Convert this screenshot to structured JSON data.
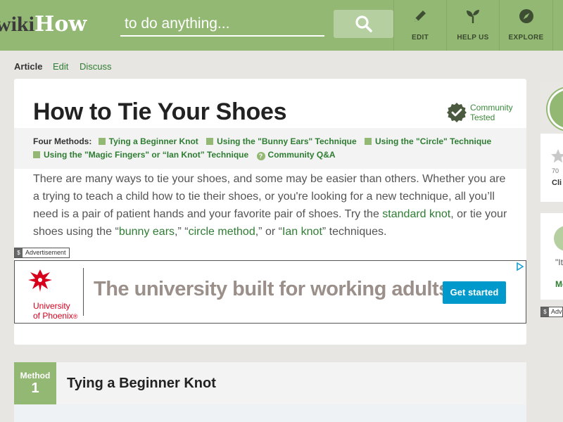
{
  "header": {
    "logo_wiki": "wiki",
    "logo_how": "How",
    "search_placeholder": "to do anything...",
    "nav": [
      {
        "label": "EDIT",
        "icon": "pencil-icon"
      },
      {
        "label": "HELP US",
        "icon": "sprout-icon"
      },
      {
        "label": "EXPLORE",
        "icon": "compass-icon"
      }
    ]
  },
  "tabs": [
    "Article",
    "Edit",
    "Discuss"
  ],
  "article": {
    "title": "How to Tie Your Shoes",
    "badge_line1": "Community",
    "badge_line2": "Tested",
    "methods_lead": "Four Methods:",
    "methods": [
      "Tying a Beginner Knot",
      "Using the \"Bunny Ears\" Technique",
      "Using the \"Circle\" Technique",
      "Using the \"Magic Fingers\" or “Ian Knot” Technique"
    ],
    "qa_link": "Community Q&A",
    "intro": {
      "p1": "There are many ways to tie your shoes, and some may be easier than others. Whether you are a trying to teach a child how to tie their shoes, or you're looking for a new technique, all you’ll need is a pair of patient hands and your favorite pair of shoes. Try the ",
      "l1": "standard knot",
      "p2": ", or tie your shoes using the “",
      "l2": "bunny ears",
      "p3": ",” “",
      "l3": "circle method",
      "p4": ",” or “",
      "l4": "Ian knot",
      "p5": "” techniques."
    }
  },
  "ad": {
    "tag": "Advertisement",
    "tag_icon": "$",
    "brand_line1": "University",
    "brand_line2": "of Phoenix",
    "brand_mark": "®",
    "headline": "The university built for working adults",
    "cta": "Get started",
    "brand_color": "#d6001c",
    "cta_color": "#0099cc"
  },
  "method": {
    "word": "Method",
    "number": "1",
    "title": "Tying a Beginner Knot"
  },
  "sidebar": {
    "count_partial": "70",
    "cli_partial": "Cli",
    "quote_partial": "\"It",
    "more_partial": "Mo",
    "ad_tag_partial": "Adv"
  },
  "colors": {
    "brand_green": "#93b874",
    "link_green": "#2e7d32",
    "page_bg": "#e8e6e2"
  }
}
